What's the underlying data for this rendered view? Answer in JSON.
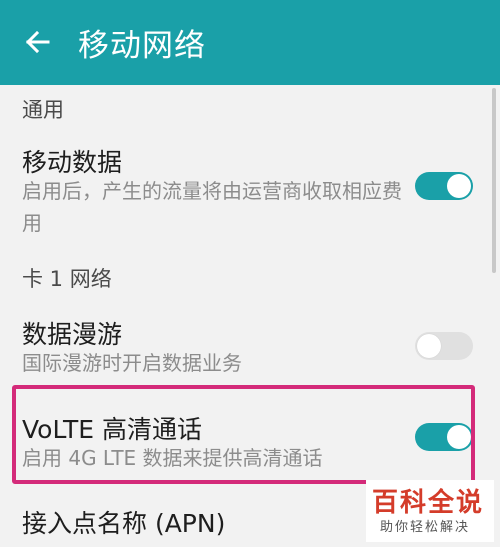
{
  "app_bar": {
    "title": "移动网络",
    "back_icon": "arrow-left-icon",
    "color": "#1aa0a8"
  },
  "sections": {
    "general": {
      "label": "通用"
    },
    "sim1": {
      "label": "卡 1 网络"
    }
  },
  "items": {
    "mobile_data": {
      "title": "移动数据",
      "subtitle": "启用后，产生的流量将由运营商收取相应费用",
      "enabled": true
    },
    "data_roaming": {
      "title": "数据漫游",
      "subtitle": "国际漫游时开启数据业务",
      "enabled": false
    },
    "volte": {
      "title": "VoLTE 高清通话",
      "subtitle": "启用 4G LTE 数据来提供高清通话",
      "enabled": true
    },
    "apn": {
      "title": "接入点名称 (APN)"
    }
  },
  "watermark": {
    "main": "百科全说",
    "sub": "助你轻松解决"
  },
  "colors": {
    "accent": "#1aa0a8",
    "highlight_border": "#d42b7a",
    "watermark_red": "#d43c2a"
  }
}
